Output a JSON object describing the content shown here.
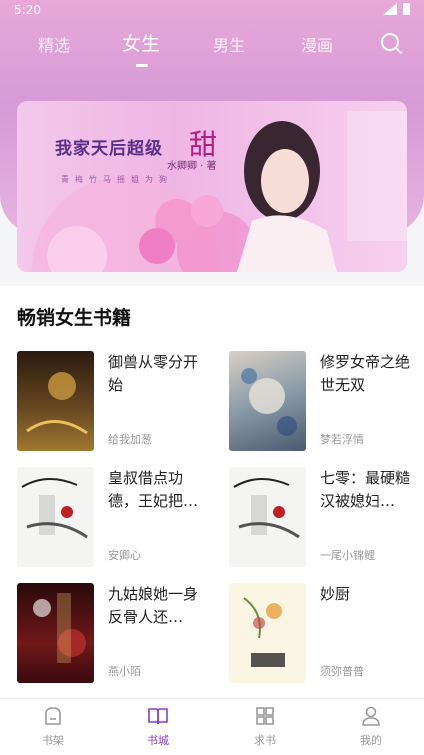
{
  "status_bar": {
    "time": "5:20"
  },
  "tabs": [
    {
      "label": "精选",
      "active": false
    },
    {
      "label": "女生",
      "active": true
    },
    {
      "label": "男生",
      "active": false
    },
    {
      "label": "漫画",
      "active": false
    }
  ],
  "banner": {
    "title": "我家天后超级",
    "title_emphasis": "甜",
    "author": "水卿卿 · 著",
    "tagline": "青梅竹马摇姐为狗"
  },
  "section": {
    "title": "畅销女生书籍"
  },
  "books": [
    {
      "title": "御兽从零分开始",
      "author": "给我加葱"
    },
    {
      "title": "修罗女帝之绝世无双",
      "author": "梦若浮情"
    },
    {
      "title": "皇叔借点功德，王妃把…",
      "author": "安卿心"
    },
    {
      "title": "七零：最硬糙汉被媳妇…",
      "author": "一尾小锦鲤"
    },
    {
      "title": "九姑娘她一身反骨人还…",
      "author": "燕小陌"
    },
    {
      "title": "妙厨",
      "author": "须弥普普"
    }
  ],
  "bottom_nav": [
    {
      "label": "书架",
      "icon": "bookshelf-icon"
    },
    {
      "label": "书城",
      "icon": "book-open-icon",
      "active": true
    },
    {
      "label": "求书",
      "icon": "grid-icon"
    },
    {
      "label": "我的",
      "icon": "user-icon"
    }
  ],
  "colors": {
    "accent": "#8a3cc8",
    "header": "#d69ad6"
  }
}
